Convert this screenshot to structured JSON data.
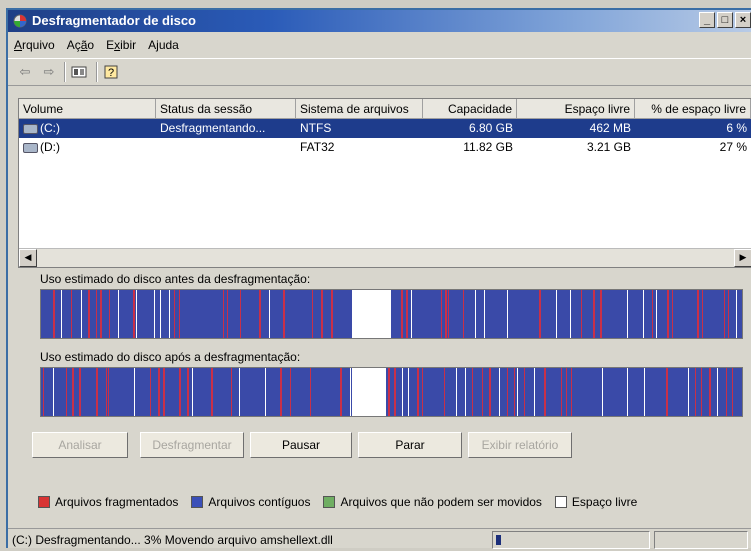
{
  "window": {
    "title": "Desfragmentador de disco"
  },
  "menu": [
    {
      "prefix": "",
      "u": "A",
      "suffix": "rquivo"
    },
    {
      "prefix": "Aç",
      "u": "ã",
      "suffix": "o"
    },
    {
      "prefix": "E",
      "u": "x",
      "suffix": "ibir"
    },
    {
      "prefix": "A",
      "u": "j",
      "suffix": "uda"
    }
  ],
  "volumes": {
    "columns": [
      "Volume",
      "Status da sessão",
      "Sistema de arquivos",
      "Capacidade",
      "Espaço livre",
      "% de espaço livre"
    ],
    "rows": [
      {
        "volume": "(C:)",
        "status": "Desfragmentando...",
        "fs": "NTFS",
        "capacity": "6.80 GB",
        "free": "462 MB",
        "pct": "6 %",
        "selected": true
      },
      {
        "volume": "(D:)",
        "status": "",
        "fs": "FAT32",
        "capacity": "11.82 GB",
        "free": "3.21 GB",
        "pct": "27 %",
        "selected": false
      }
    ]
  },
  "analysis": {
    "before_label": "Uso estimado do disco antes da desfragmentação:",
    "after_label": "Uso estimado do disco após a desfragmentação:"
  },
  "buttons": {
    "analyze": "Analisar",
    "defrag": "Desfragmentar",
    "pause": "Pausar",
    "stop": "Parar",
    "report": "Exibir relatório"
  },
  "legend": [
    {
      "label": "Arquivos fragmentados",
      "color": "#d83434"
    },
    {
      "label": "Arquivos contíguos",
      "color": "#3a4fb8"
    },
    {
      "label": "Arquivos que não podem ser movidos",
      "color": "#6fae62"
    },
    {
      "label": "Espaço livre",
      "color": "#ffffff"
    }
  ],
  "colors": {
    "fragmented": "#c93048",
    "contiguous": "#3a4aa8",
    "free": "#ffffff"
  },
  "status": {
    "text": "(C:) Desfragmentando... 3%  Movendo arquivo amshellext.dll",
    "progress_percent": 3
  }
}
